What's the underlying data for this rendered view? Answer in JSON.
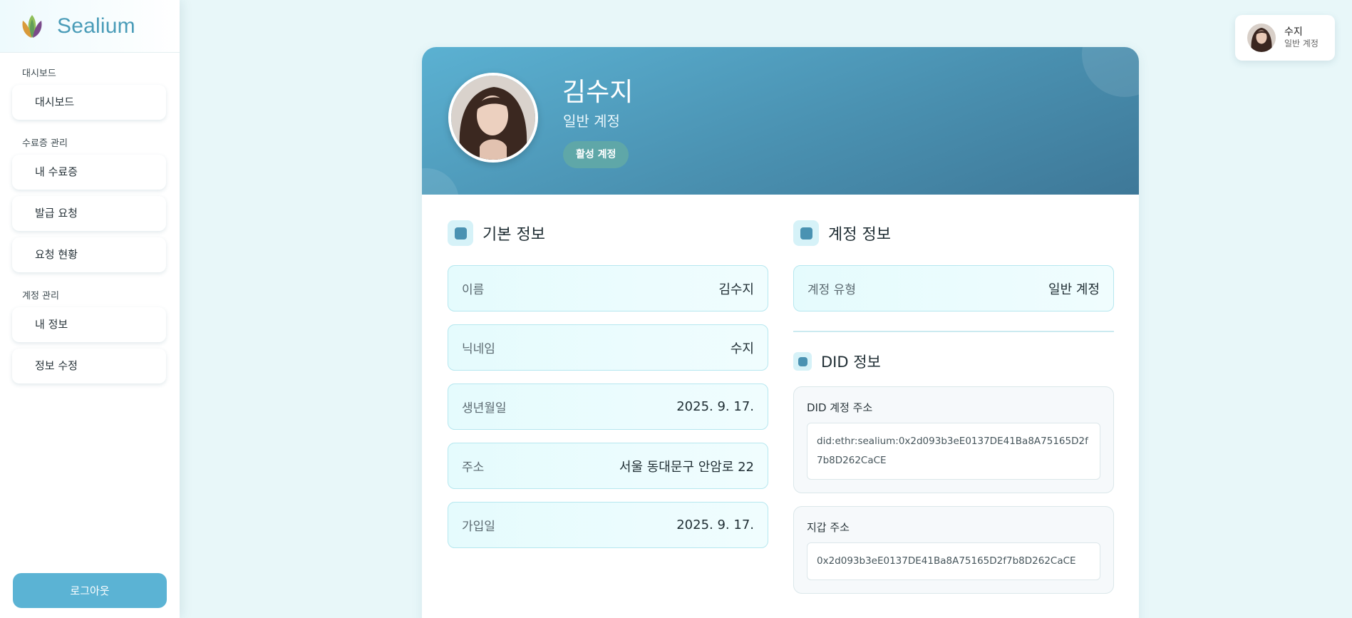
{
  "app": {
    "name": "Sealium"
  },
  "sidebar": {
    "sections": [
      {
        "label": "대시보드",
        "items": [
          {
            "label": "대시보드"
          }
        ]
      },
      {
        "label": "수료증 관리",
        "items": [
          {
            "label": "내 수료증"
          },
          {
            "label": "발급 요청"
          },
          {
            "label": "요청 현황"
          }
        ]
      },
      {
        "label": "계정 관리",
        "items": [
          {
            "label": "내 정보"
          },
          {
            "label": "정보 수정"
          }
        ]
      }
    ],
    "logout_label": "로그아웃"
  },
  "user_chip": {
    "name": "수지",
    "role": "일반 계정"
  },
  "profile": {
    "name": "김수지",
    "role": "일반 계정",
    "status": "활성 계정"
  },
  "basic_info": {
    "title": "기본 정보",
    "rows": [
      {
        "label": "이름",
        "value": "김수지"
      },
      {
        "label": "닉네임",
        "value": "수지"
      },
      {
        "label": "생년월일",
        "value": "2025. 9. 17."
      },
      {
        "label": "주소",
        "value": "서울 동대문구 안암로 22"
      },
      {
        "label": "가입일",
        "value": "2025. 9. 17."
      }
    ]
  },
  "account_info": {
    "title": "계정 정보",
    "rows": [
      {
        "label": "계정 유형",
        "value": "일반 계정"
      }
    ]
  },
  "did_info": {
    "title": "DID 정보",
    "did_label": "DID 계정 주소",
    "did_value": "did:ethr:sealium:0x2d093b3eE0137DE41Ba8A75165D2f7b8D262CaCE",
    "wallet_label": "지갑 주소",
    "wallet_value": "0x2d093b3eE0137DE41Ba8A75165D2f7b8D262CaCE"
  },
  "colors": {
    "accent": "#5bb3d4",
    "header_gradient_start": "#5bb1d2",
    "header_gradient_end": "#3e7898",
    "badge": "#5fa7a8",
    "background": "#e8f7f9"
  }
}
